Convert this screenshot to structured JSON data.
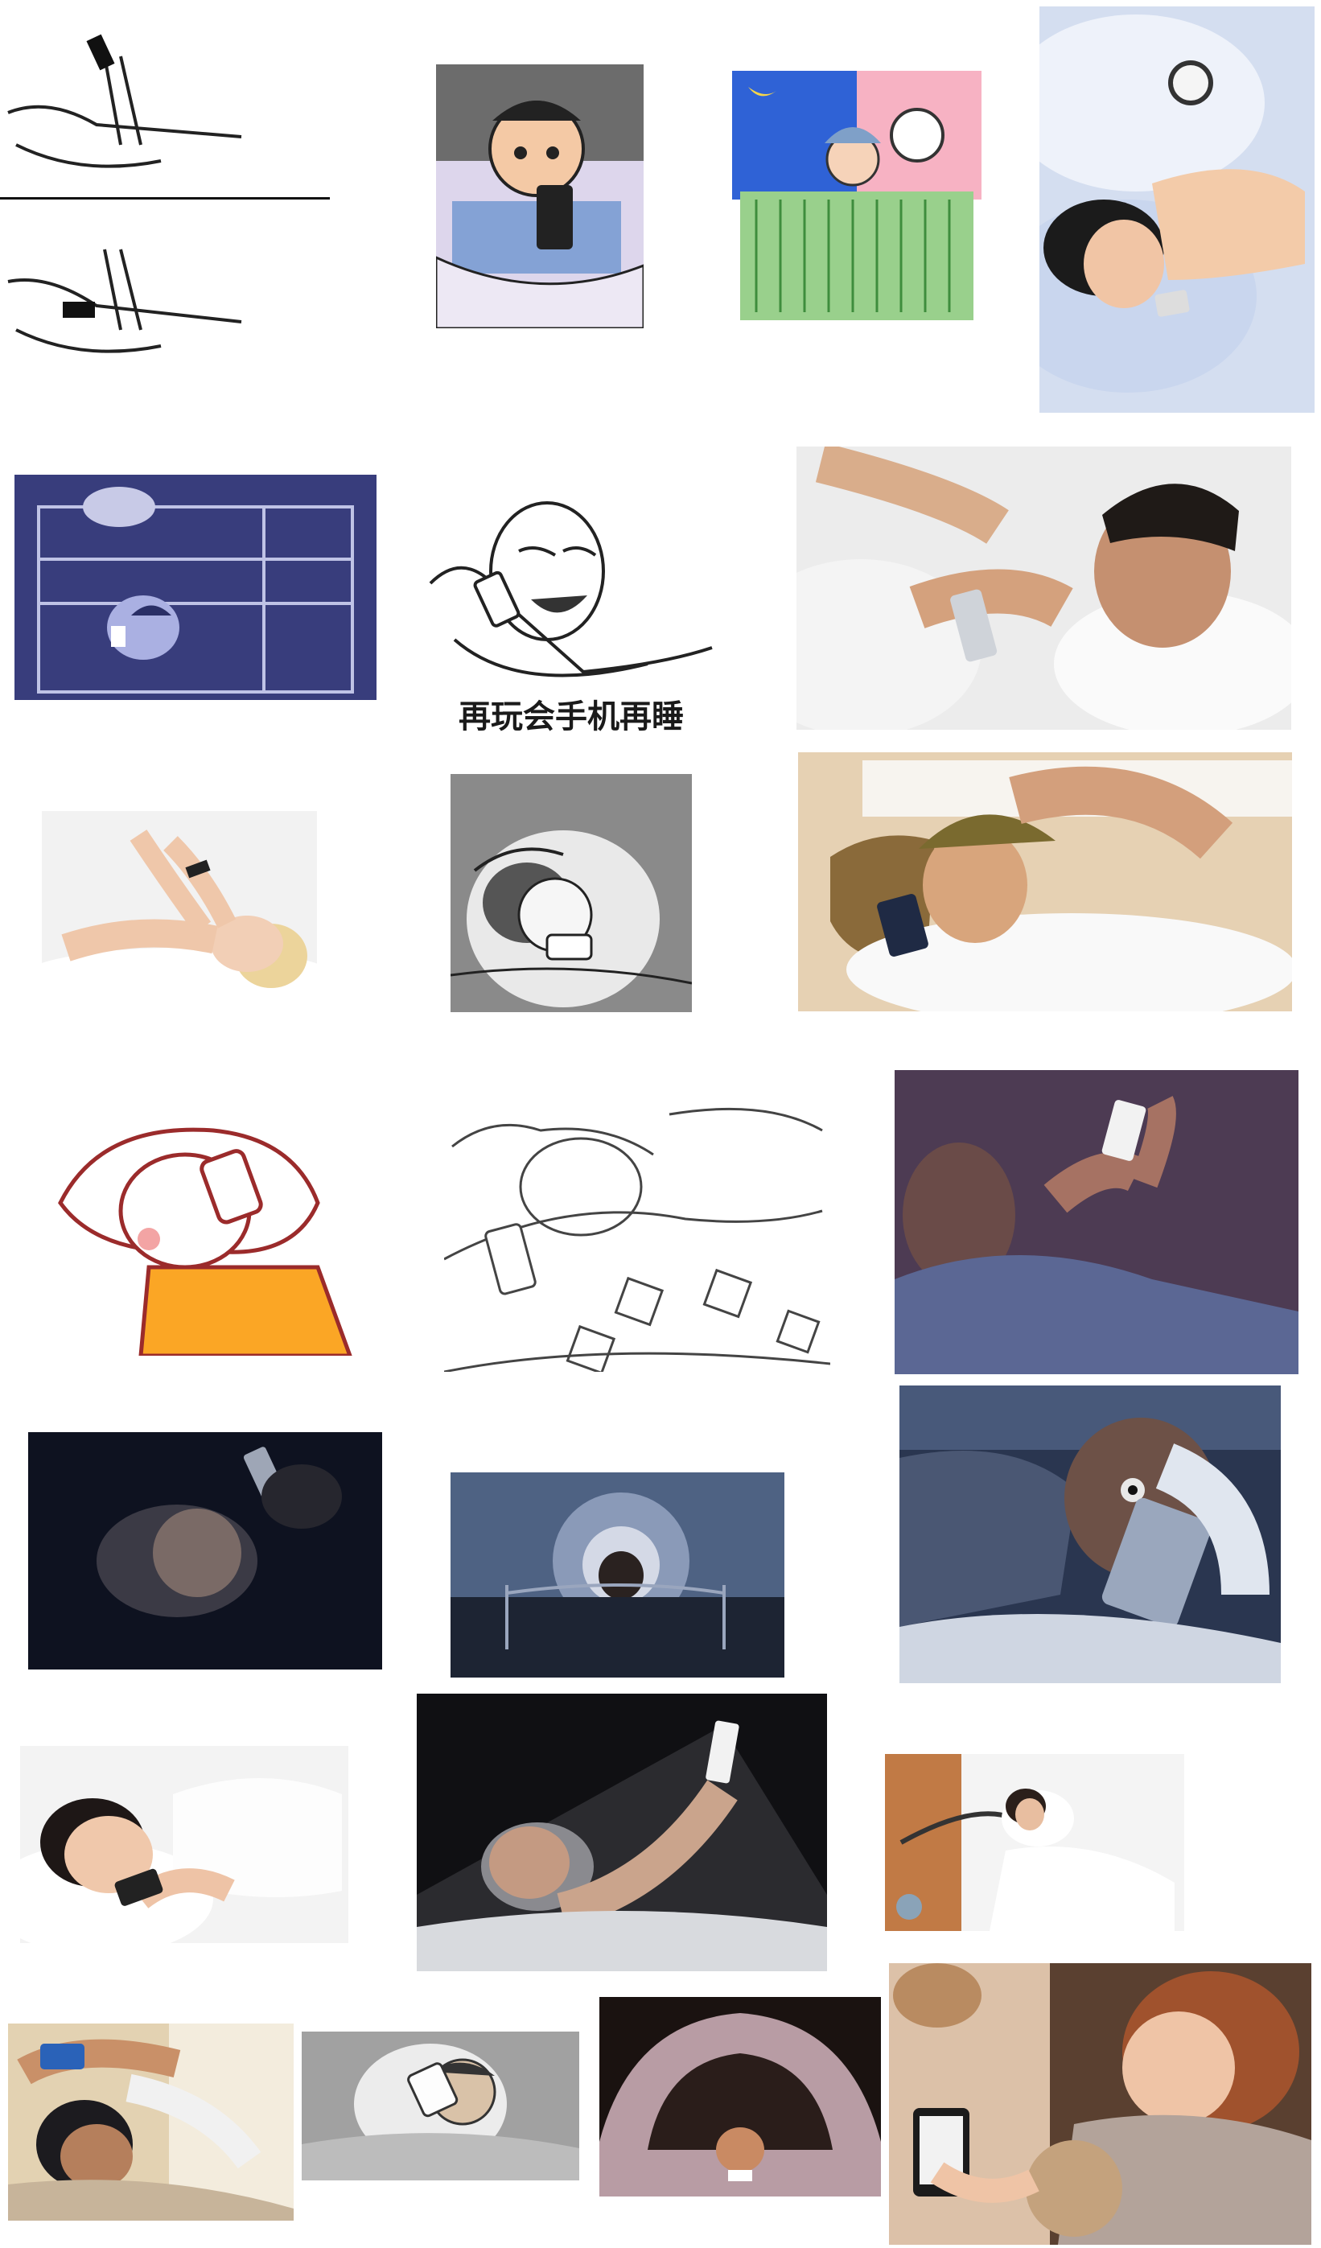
{
  "collage": {
    "caption": "再玩会手机再睡",
    "tiles": [
      {
        "id": 1,
        "subject": "sketch-hand-dropping-phone"
      },
      {
        "id": 2,
        "subject": "cartoon-man-phone-in-bed"
      },
      {
        "id": 3,
        "subject": "cartoon-child-phone-night"
      },
      {
        "id": 4,
        "subject": "photo-woman-phone-alarm-clock"
      },
      {
        "id": 5,
        "subject": "cartoon-bunk-bed-phones"
      },
      {
        "id": 6,
        "subject": "meme-face-phone"
      },
      {
        "id": 7,
        "subject": "photo-man-phone-white-bed"
      },
      {
        "id": 8,
        "subject": "photo-blonde-woman-phone"
      },
      {
        "id": 9,
        "subject": "sketch-girl-phone-glow"
      },
      {
        "id": 10,
        "subject": "photo-woman-phone-pillow"
      },
      {
        "id": 11,
        "subject": "cartoon-cat-phone"
      },
      {
        "id": 12,
        "subject": "sketch-under-covers-phone"
      },
      {
        "id": 13,
        "subject": "illustration-man-phone-purple"
      },
      {
        "id": 14,
        "subject": "photo-dark-man-phone"
      },
      {
        "id": 15,
        "subject": "photo-dark-bed-phone-glow"
      },
      {
        "id": 16,
        "subject": "photo-bald-man-phone-shocked"
      },
      {
        "id": 17,
        "subject": "photo-woman-phone-smile"
      },
      {
        "id": 18,
        "subject": "photo-man-phone-light-beam"
      },
      {
        "id": 19,
        "subject": "photo-woman-phone-holder"
      },
      {
        "id": 20,
        "subject": "photo-man-phone-hands-up"
      },
      {
        "id": 21,
        "subject": "cartoon-man-phone-gray"
      },
      {
        "id": 22,
        "subject": "photo-under-blanket-phone"
      },
      {
        "id": 23,
        "subject": "photo-woman-phone-teddy"
      }
    ]
  }
}
